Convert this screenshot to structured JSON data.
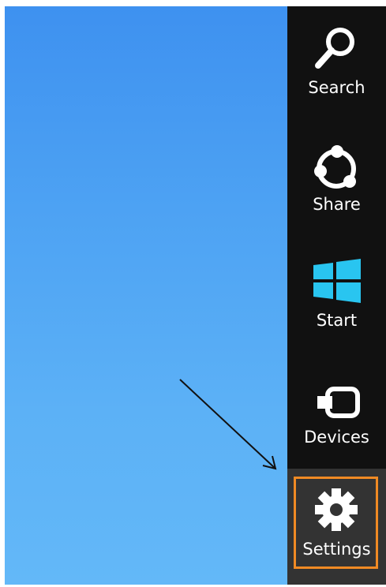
{
  "charms": {
    "search": {
      "label": "Search",
      "icon": "search-icon"
    },
    "share": {
      "label": "Share",
      "icon": "share-icon"
    },
    "start": {
      "label": "Start",
      "icon": "windows-logo-icon"
    },
    "devices": {
      "label": "Devices",
      "icon": "devices-icon"
    },
    "settings": {
      "label": "Settings",
      "icon": "gear-icon",
      "highlighted": true
    }
  },
  "colors": {
    "charm_bar": "#111111",
    "settings_bg": "#333333",
    "highlight": "#f08a24",
    "start_logo": "#29c5f0",
    "desktop": "#4da2f3"
  },
  "annotation": {
    "icon": "arrow-pointer"
  }
}
